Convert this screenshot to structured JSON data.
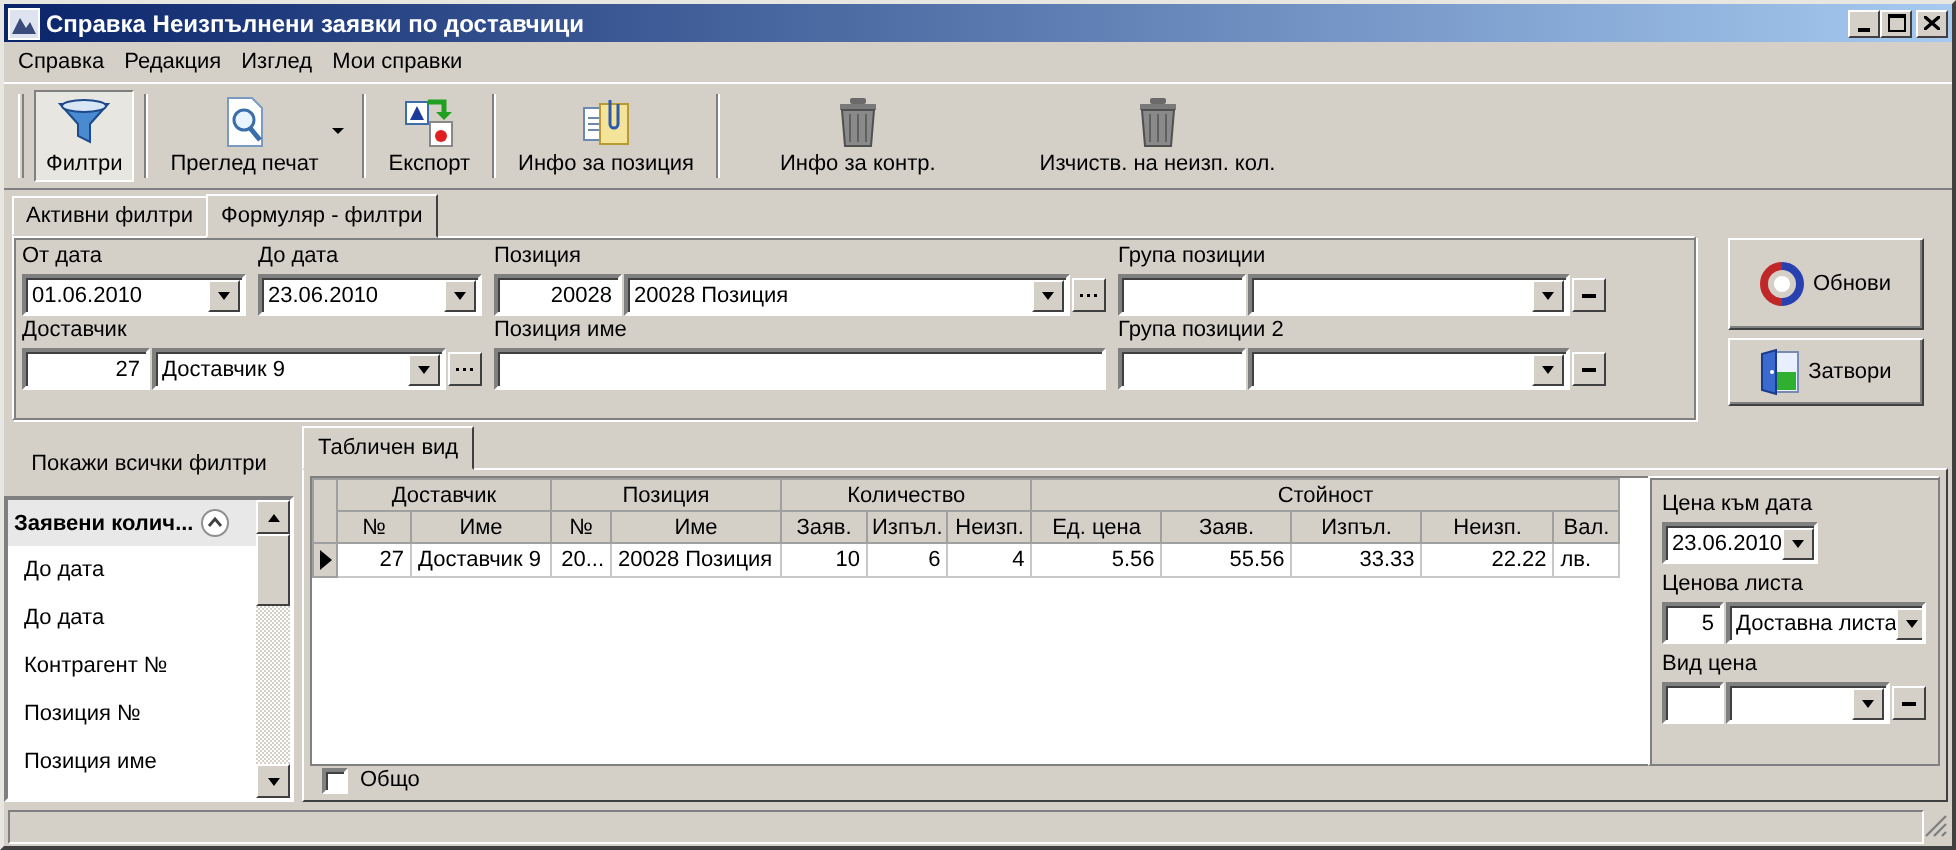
{
  "window": {
    "title": "Справка Неизпълнени заявки по доставчици"
  },
  "menu": [
    "Справка",
    "Редакция",
    "Изглед",
    "Мои справки"
  ],
  "toolbar": [
    {
      "label": "Филтри",
      "kind": "button",
      "selected": true
    },
    {
      "label": "Преглед печат",
      "kind": "split",
      "selected": false
    },
    {
      "label": "Експорт",
      "kind": "button",
      "selected": false
    },
    {
      "label": "Инфо за позиция",
      "kind": "button",
      "selected": false
    },
    {
      "label": "Инфо за контр.",
      "kind": "button",
      "selected": false
    },
    {
      "label": "Изчиств. на неизп. кол.",
      "kind": "button",
      "selected": false
    }
  ],
  "filter_tabs": [
    {
      "label": "Активни филтри",
      "selected": false
    },
    {
      "label": "Формуляр - филтри",
      "selected": true
    }
  ],
  "filters": {
    "from_date": {
      "label": "От дата",
      "value": "01.06.2010"
    },
    "to_date": {
      "label": "До дата",
      "value": "23.06.2010"
    },
    "position": {
      "label": "Позиция",
      "code": "20028",
      "value": "20028 Позиция"
    },
    "position_group": {
      "label": "Група позиции"
    },
    "supplier": {
      "label": "Доставчик",
      "code": "27",
      "value": "Доставчик 9"
    },
    "position_name": {
      "label": "Позиция име"
    },
    "position_group_2": {
      "label": "Група позиции 2"
    }
  },
  "actions": [
    "Обнови",
    "Затвори"
  ],
  "show_all_filters": "Покажи всички филтри",
  "filter_list": {
    "header": "Заявени колич...",
    "items": [
      "До дата",
      "До дата",
      "Контрагент №",
      "Позиция №",
      "Позиция име"
    ]
  },
  "result_tabs": [
    {
      "label": "Табличен вид",
      "selected": true
    }
  ],
  "table": {
    "groups": [
      {
        "label": "Доставчик",
        "columns": [
          "№",
          "Име"
        ]
      },
      {
        "label": "Позиция",
        "columns": [
          "№",
          "Име"
        ]
      },
      {
        "label": "Количество",
        "columns": [
          "Заяв.",
          "Изпъл.",
          "Неизп."
        ]
      },
      {
        "label": "Стойност",
        "columns": [
          "Ед. цена",
          "Заяв.",
          "Изпъл.",
          "Неизп.",
          "Вал."
        ]
      }
    ],
    "rows": [
      {
        "selected": true,
        "cells": [
          "27",
          "Доставчик 9",
          "20...",
          "20028 Позиция",
          "10",
          "6",
          "4",
          "5.56",
          "55.56",
          "33.33",
          "22.22",
          "лв."
        ]
      }
    ]
  },
  "total": {
    "label": "Общо",
    "checked": false
  },
  "price_options": {
    "price_date": {
      "label": "Цена към дата",
      "value": "23.06.2010"
    },
    "price_list": {
      "label": "Ценова листа",
      "code": "5",
      "value": "Доставна листа"
    },
    "price_type": {
      "label": "Вид цена"
    }
  }
}
